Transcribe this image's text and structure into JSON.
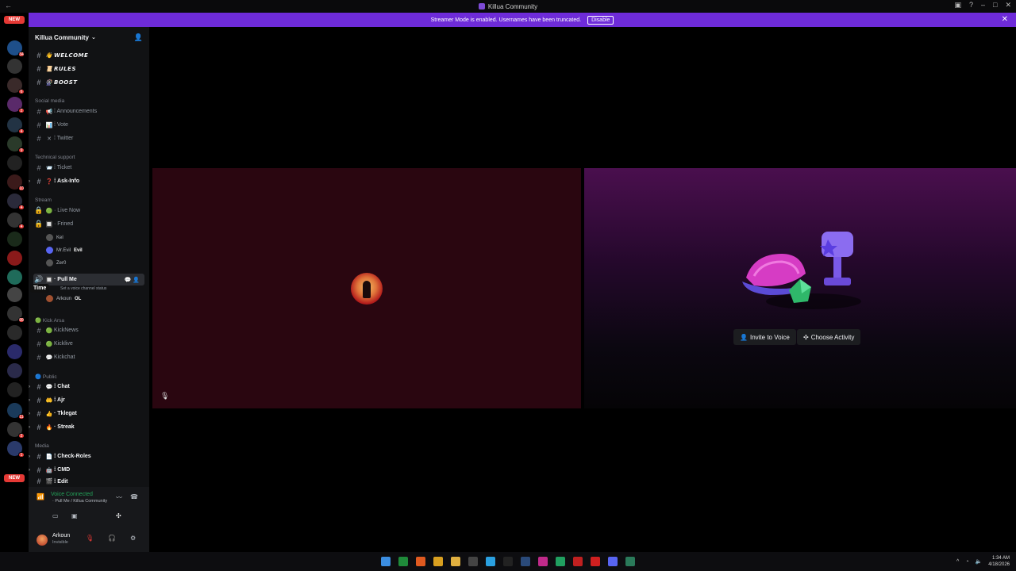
{
  "window": {
    "title": "Killua Community"
  },
  "banner": {
    "text": "Streamer Mode is enabled. Usernames have been truncated.",
    "button": "Disable"
  },
  "servers": {
    "new_badge": "NEW",
    "items": [
      {
        "badge": "34"
      },
      {
        "badge": ""
      },
      {
        "badge": "6"
      },
      {
        "badge": "2"
      },
      {
        "badge": "4"
      },
      {
        "badge": "9"
      },
      {
        "badge": ""
      },
      {
        "badge": "10"
      },
      {
        "badge": "4"
      },
      {
        "badge": "4"
      },
      {
        "badge": ""
      },
      {
        "badge": ""
      },
      {
        "badge": ""
      },
      {
        "badge": ""
      },
      {
        "badge": "99"
      },
      {
        "badge": ""
      },
      {
        "badge": ""
      },
      {
        "badge": ""
      },
      {
        "badge": ""
      },
      {
        "badge": "11"
      },
      {
        "badge": "2"
      },
      {
        "badge": "1"
      }
    ]
  },
  "guild": {
    "name": "Killua Community"
  },
  "channels": {
    "welcome": {
      "emoji": "👋",
      "label": "𝙒𝙀𝙇𝘾𝙊𝙈𝙀"
    },
    "rules": {
      "emoji": "📜",
      "label": "𝙍𝙐𝙇𝙀𝙎"
    },
    "boost": {
      "emoji": "🎡",
      "label": "𝘽𝙊𝙊𝙎𝙏"
    },
    "cat_social": "Social media",
    "announcements": {
      "emoji": "📢",
      "label": "⁞ Announcements"
    },
    "vote": {
      "emoji": "📊",
      "label": "⁞ Vote"
    },
    "twitter": {
      "emoji": "✕",
      "label": "⁞ Twitter"
    },
    "cat_tech": "Technical support",
    "ticket": {
      "emoji": "📨",
      "label": "⁞ Ticket"
    },
    "askinfo": {
      "emoji": "❓",
      "label": "⁞ Ask-Info"
    },
    "cat_stream": "Stream",
    "livenow": {
      "emoji": "🟢",
      "label": "· Live Now"
    },
    "frined": {
      "emoji": "🔲",
      "label": "· Frined"
    },
    "voice_users": [
      "Kel",
      "Mr.Evil",
      "Zer0"
    ],
    "evil_tag": "Evil",
    "pullme": {
      "emoji": "🔲",
      "label": "· Pull Me"
    },
    "pullme_status": "Set a voice channel status",
    "arkoun": "Arkoun",
    "arkoun_tag": "OL",
    "tooltip": "Time",
    "cat_kick": "Kick Arsa",
    "kicknews": {
      "emoji": "🟢",
      "label": "KickNews"
    },
    "kicklive": {
      "emoji": "🟢",
      "label": "Kicklive"
    },
    "kickchat": {
      "emoji": "💬",
      "label": "Kickchat"
    },
    "cat_public": "Public",
    "chat": {
      "emoji": "💬",
      "label": "⁞ Chat"
    },
    "ajr": {
      "emoji": "🤲",
      "label": "⁞ Ajr"
    },
    "tklegat": {
      "emoji": "👍",
      "label": "· Tklegat"
    },
    "streak": {
      "emoji": "🔥",
      "label": "· Streak"
    },
    "cat_media": "Media",
    "checkroles": {
      "emoji": "📄",
      "label": "⁞ Check-Roles"
    },
    "cmd": {
      "emoji": "🤖",
      "label": "⁞ CMD"
    },
    "edit": {
      "emoji": "🎬",
      "label": "⁞ Edit"
    }
  },
  "voice_panel": {
    "status": "Voice Connected",
    "channel": "· Pull Me / Killua Community"
  },
  "user": {
    "name": "Arkoun",
    "status": "Invisible"
  },
  "activity": {
    "invite": "Invite to Voice",
    "choose": "Choose Activity"
  },
  "clock": {
    "time": "1:34 AM",
    "date": "4/18/2026"
  },
  "colors": {
    "banner": "#6e2bd9",
    "voice_green": "#23a55a",
    "badge_red": "#e53935"
  }
}
